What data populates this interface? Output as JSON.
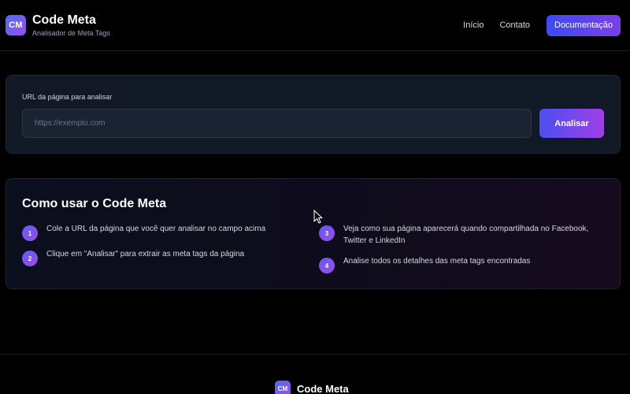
{
  "header": {
    "logo_text": "CM",
    "title": "Code Meta",
    "subtitle": "Analisador de Meta Tags",
    "nav": {
      "home": "Início",
      "contact": "Contato",
      "docs": "Documentação"
    }
  },
  "url_form": {
    "label": "URL da página para analisar",
    "input_value": "",
    "input_placeholder": "https://exemplo.com",
    "button_label": "Analisar"
  },
  "howto": {
    "title": "Como usar o Code Meta",
    "steps": [
      {
        "num": "1",
        "text": "Cole a URL da página que você quer analisar no campo acima"
      },
      {
        "num": "2",
        "text": "Clique em \"Analisar\" para extrair as meta tags da página"
      },
      {
        "num": "3",
        "text": "Veja como sua página aparecerá quando compartilhada no Facebook, Twitter e LinkedIn"
      },
      {
        "num": "4",
        "text": "Analise todos os detalhes das meta tags encontradas"
      }
    ]
  },
  "footer": {
    "logo_text": "CM",
    "title": "Code Meta"
  },
  "colors": {
    "background": "#000000",
    "accent_start": "#3b4cf0",
    "accent_end": "#a13fe6",
    "card": "#111826"
  },
  "icons": {
    "cursor": "arrow-cursor-icon"
  }
}
